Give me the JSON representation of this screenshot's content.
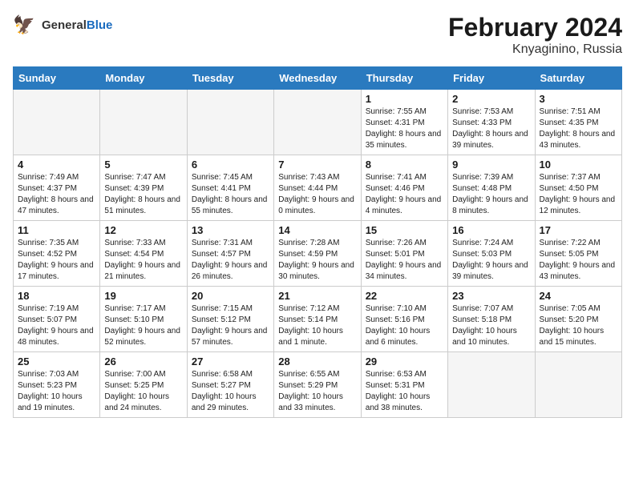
{
  "header": {
    "logo_general": "General",
    "logo_blue": "Blue",
    "main_title": "February 2024",
    "subtitle": "Knyaginino, Russia"
  },
  "weekdays": [
    "Sunday",
    "Monday",
    "Tuesday",
    "Wednesday",
    "Thursday",
    "Friday",
    "Saturday"
  ],
  "weeks": [
    [
      {
        "day": "",
        "empty": true
      },
      {
        "day": "",
        "empty": true
      },
      {
        "day": "",
        "empty": true
      },
      {
        "day": "",
        "empty": true
      },
      {
        "day": "1",
        "sunrise": "7:55 AM",
        "sunset": "4:31 PM",
        "daylight": "8 hours and 35 minutes."
      },
      {
        "day": "2",
        "sunrise": "7:53 AM",
        "sunset": "4:33 PM",
        "daylight": "8 hours and 39 minutes."
      },
      {
        "day": "3",
        "sunrise": "7:51 AM",
        "sunset": "4:35 PM",
        "daylight": "8 hours and 43 minutes."
      }
    ],
    [
      {
        "day": "4",
        "sunrise": "7:49 AM",
        "sunset": "4:37 PM",
        "daylight": "8 hours and 47 minutes."
      },
      {
        "day": "5",
        "sunrise": "7:47 AM",
        "sunset": "4:39 PM",
        "daylight": "8 hours and 51 minutes."
      },
      {
        "day": "6",
        "sunrise": "7:45 AM",
        "sunset": "4:41 PM",
        "daylight": "8 hours and 55 minutes."
      },
      {
        "day": "7",
        "sunrise": "7:43 AM",
        "sunset": "4:44 PM",
        "daylight": "9 hours and 0 minutes."
      },
      {
        "day": "8",
        "sunrise": "7:41 AM",
        "sunset": "4:46 PM",
        "daylight": "9 hours and 4 minutes."
      },
      {
        "day": "9",
        "sunrise": "7:39 AM",
        "sunset": "4:48 PM",
        "daylight": "9 hours and 8 minutes."
      },
      {
        "day": "10",
        "sunrise": "7:37 AM",
        "sunset": "4:50 PM",
        "daylight": "9 hours and 12 minutes."
      }
    ],
    [
      {
        "day": "11",
        "sunrise": "7:35 AM",
        "sunset": "4:52 PM",
        "daylight": "9 hours and 17 minutes."
      },
      {
        "day": "12",
        "sunrise": "7:33 AM",
        "sunset": "4:54 PM",
        "daylight": "9 hours and 21 minutes."
      },
      {
        "day": "13",
        "sunrise": "7:31 AM",
        "sunset": "4:57 PM",
        "daylight": "9 hours and 26 minutes."
      },
      {
        "day": "14",
        "sunrise": "7:28 AM",
        "sunset": "4:59 PM",
        "daylight": "9 hours and 30 minutes."
      },
      {
        "day": "15",
        "sunrise": "7:26 AM",
        "sunset": "5:01 PM",
        "daylight": "9 hours and 34 minutes."
      },
      {
        "day": "16",
        "sunrise": "7:24 AM",
        "sunset": "5:03 PM",
        "daylight": "9 hours and 39 minutes."
      },
      {
        "day": "17",
        "sunrise": "7:22 AM",
        "sunset": "5:05 PM",
        "daylight": "9 hours and 43 minutes."
      }
    ],
    [
      {
        "day": "18",
        "sunrise": "7:19 AM",
        "sunset": "5:07 PM",
        "daylight": "9 hours and 48 minutes."
      },
      {
        "day": "19",
        "sunrise": "7:17 AM",
        "sunset": "5:10 PM",
        "daylight": "9 hours and 52 minutes."
      },
      {
        "day": "20",
        "sunrise": "7:15 AM",
        "sunset": "5:12 PM",
        "daylight": "9 hours and 57 minutes."
      },
      {
        "day": "21",
        "sunrise": "7:12 AM",
        "sunset": "5:14 PM",
        "daylight": "10 hours and 1 minute."
      },
      {
        "day": "22",
        "sunrise": "7:10 AM",
        "sunset": "5:16 PM",
        "daylight": "10 hours and 6 minutes."
      },
      {
        "day": "23",
        "sunrise": "7:07 AM",
        "sunset": "5:18 PM",
        "daylight": "10 hours and 10 minutes."
      },
      {
        "day": "24",
        "sunrise": "7:05 AM",
        "sunset": "5:20 PM",
        "daylight": "10 hours and 15 minutes."
      }
    ],
    [
      {
        "day": "25",
        "sunrise": "7:03 AM",
        "sunset": "5:23 PM",
        "daylight": "10 hours and 19 minutes."
      },
      {
        "day": "26",
        "sunrise": "7:00 AM",
        "sunset": "5:25 PM",
        "daylight": "10 hours and 24 minutes."
      },
      {
        "day": "27",
        "sunrise": "6:58 AM",
        "sunset": "5:27 PM",
        "daylight": "10 hours and 29 minutes."
      },
      {
        "day": "28",
        "sunrise": "6:55 AM",
        "sunset": "5:29 PM",
        "daylight": "10 hours and 33 minutes."
      },
      {
        "day": "29",
        "sunrise": "6:53 AM",
        "sunset": "5:31 PM",
        "daylight": "10 hours and 38 minutes."
      },
      {
        "day": "",
        "empty": true
      },
      {
        "day": "",
        "empty": true
      }
    ]
  ]
}
